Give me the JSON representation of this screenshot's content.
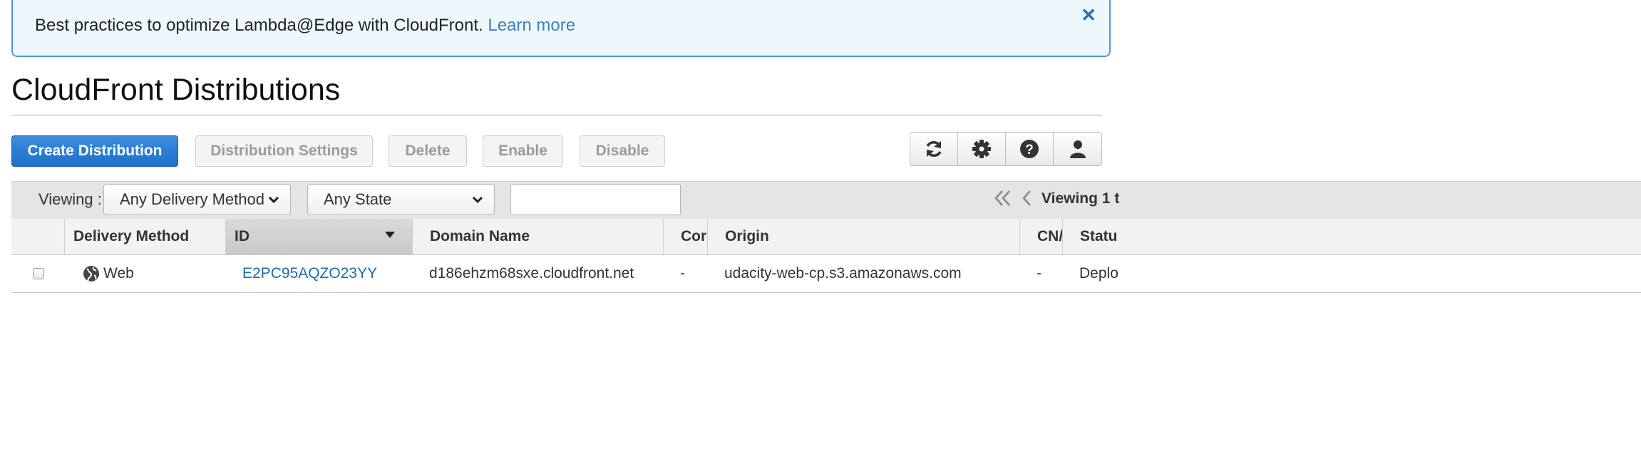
{
  "banner": {
    "text": "Best practices to optimize Lambda@Edge with CloudFront.",
    "link": "Learn more",
    "close_icon": "close-icon"
  },
  "page": {
    "title": "CloudFront Distributions"
  },
  "toolbar": {
    "create": "Create Distribution",
    "settings": "Distribution Settings",
    "delete": "Delete",
    "enable": "Enable",
    "disable": "Disable",
    "icons": [
      "refresh-icon",
      "gear-icon",
      "help-icon",
      "user-icon"
    ]
  },
  "filters": {
    "viewing_label": "Viewing :",
    "delivery_method": "Any Delivery Method",
    "state": "Any State",
    "search_value": "",
    "viewing_count": "Viewing 1 t"
  },
  "table": {
    "columns": [
      "Delivery Method",
      "ID",
      "Domain Name",
      "Cor",
      "Origin",
      "CN/",
      "Statu"
    ],
    "rows": [
      {
        "delivery_method": "Web",
        "id": "E2PC95AQZO23YY",
        "domain_name": "d186ehzm68sxe.cloudfront.net",
        "comment": "-",
        "origin": "udacity-web-cp.s3.amazonaws.com",
        "cnames": "-",
        "status": "Deplo"
      }
    ]
  },
  "colors": {
    "primary": "#1d6fc9",
    "link": "#1e6ab0",
    "banner_bg": "#eef8fc"
  }
}
